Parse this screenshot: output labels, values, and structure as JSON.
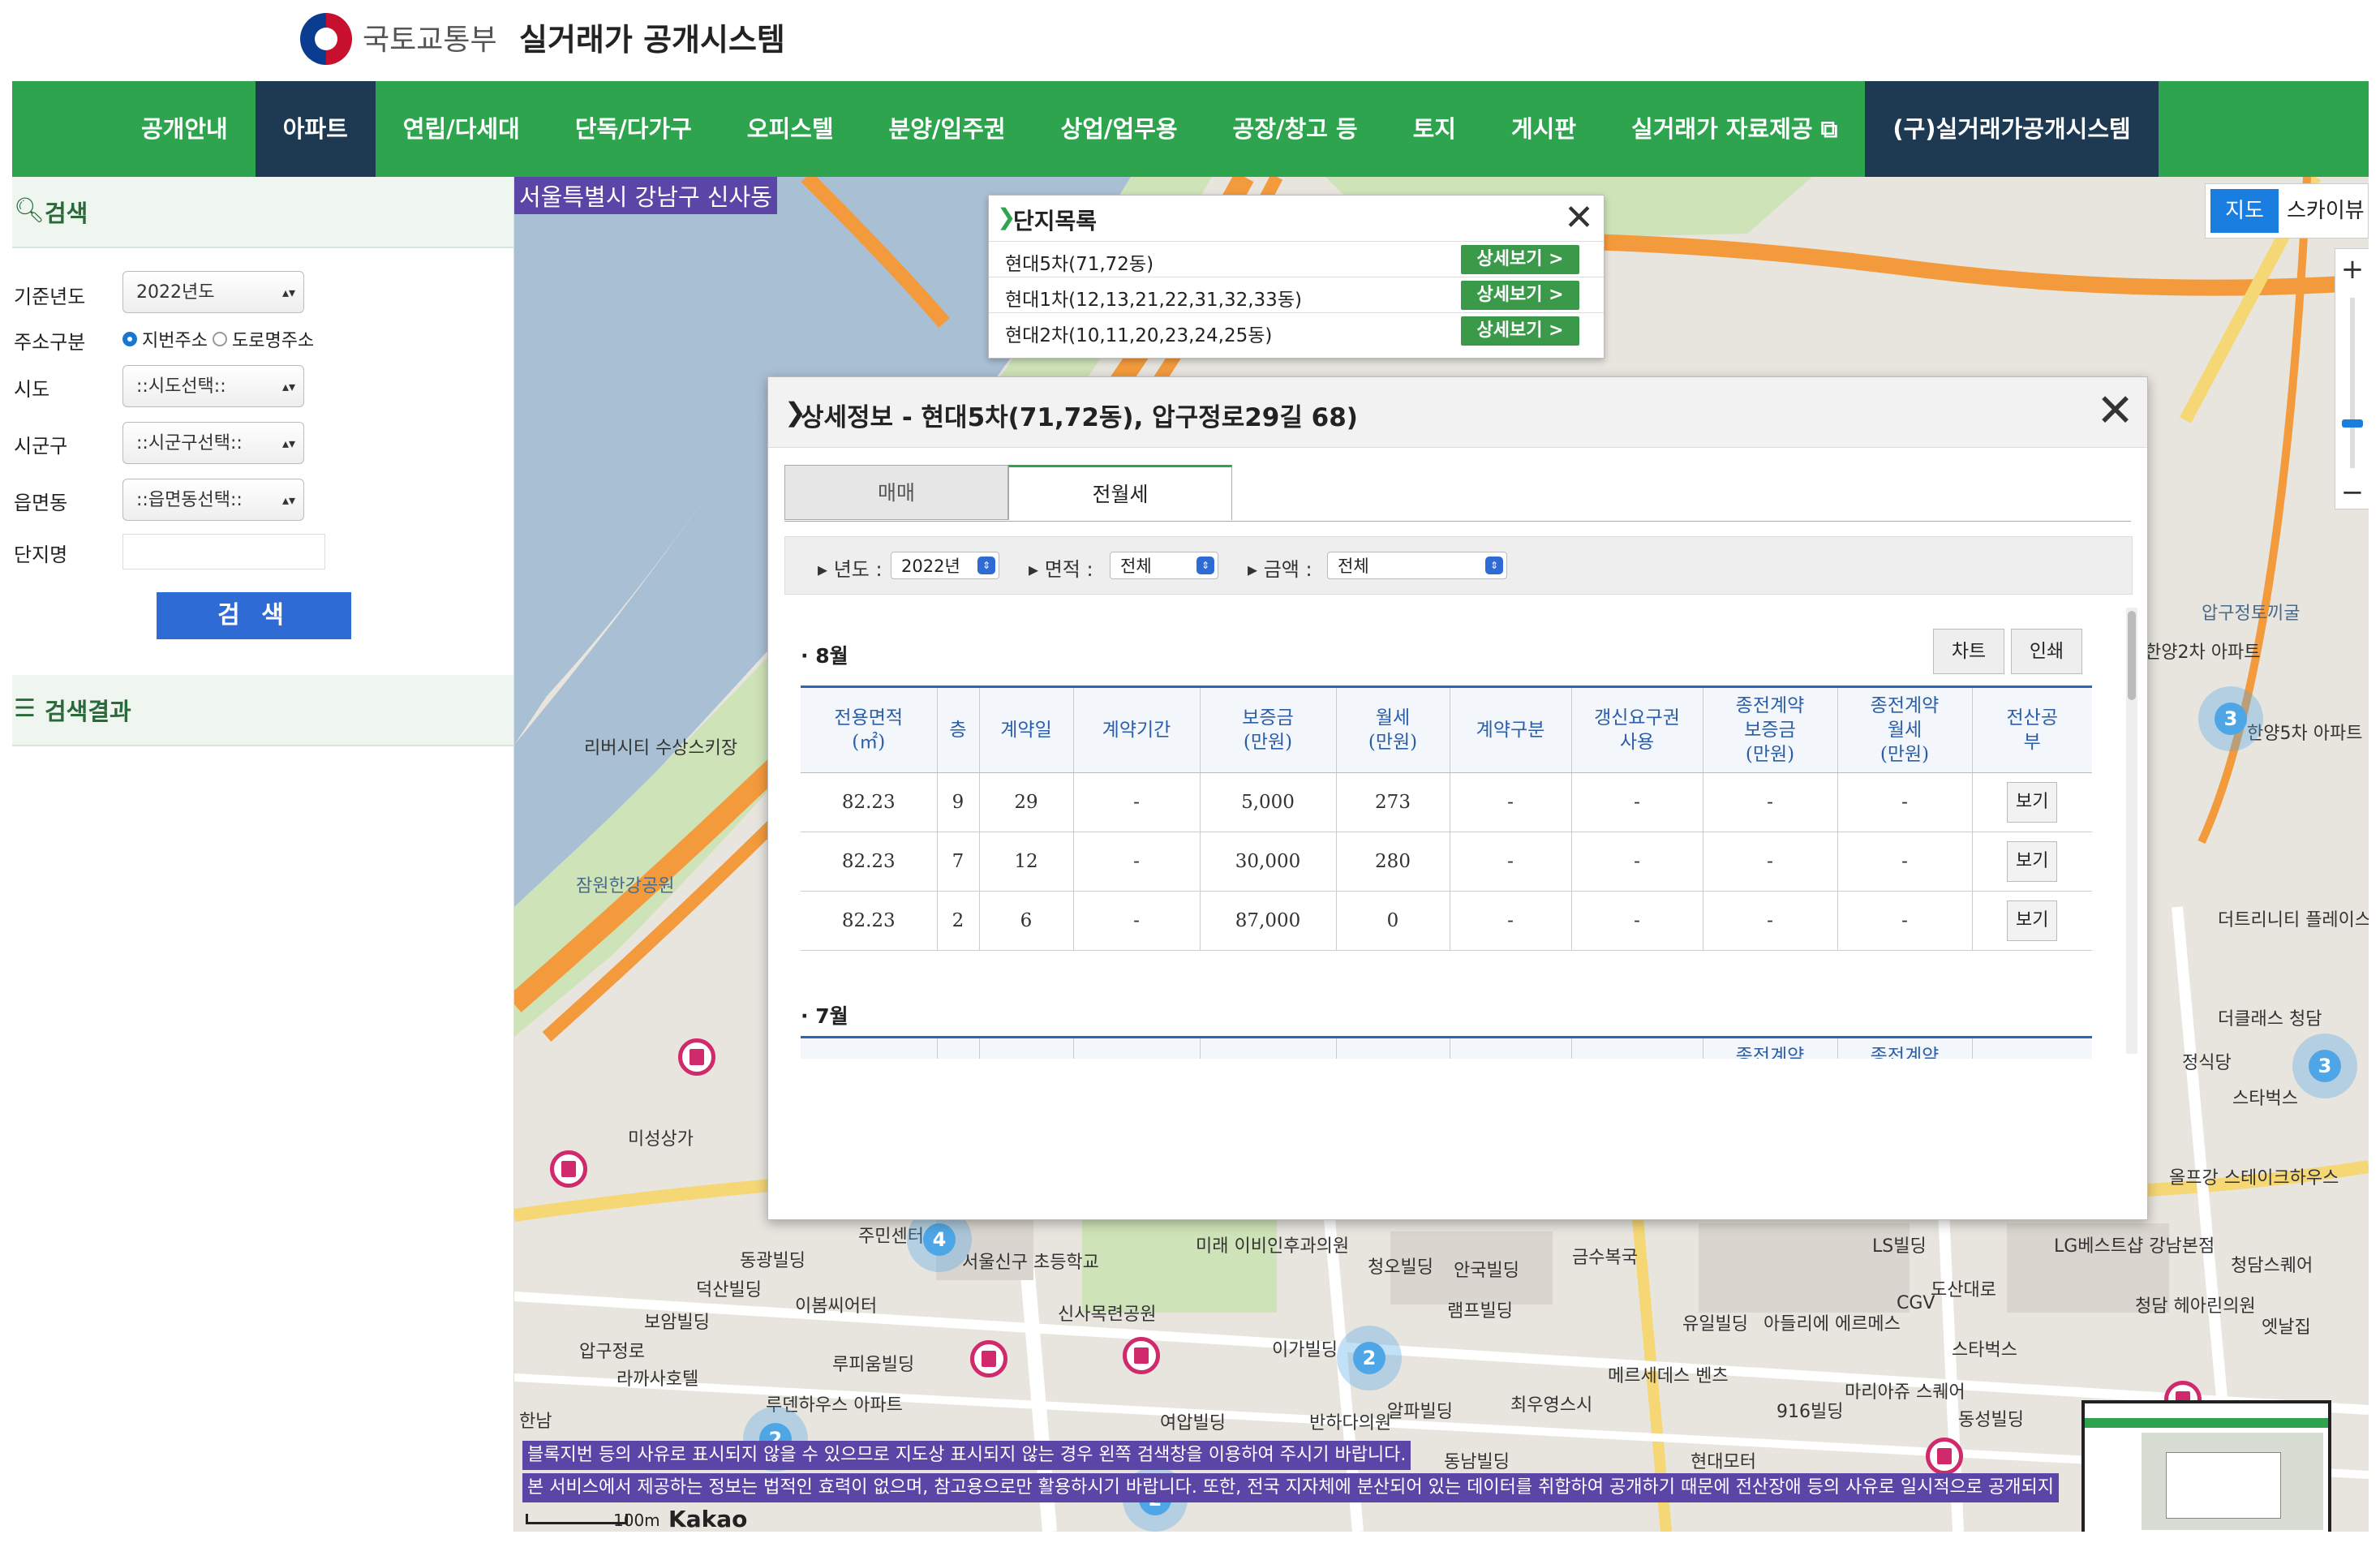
{
  "header": {
    "ministry": "국토교통부",
    "system_name": "실거래가 공개시스템"
  },
  "nav": {
    "items": [
      {
        "label": "공개안내"
      },
      {
        "label": "아파트"
      },
      {
        "label": "연립/다세대"
      },
      {
        "label": "단독/다가구"
      },
      {
        "label": "오피스텔"
      },
      {
        "label": "분양/입주권"
      },
      {
        "label": "상업/업무용"
      },
      {
        "label": "공장/창고 등"
      },
      {
        "label": "토지"
      },
      {
        "label": "게시판"
      },
      {
        "label": "실거래가 자료제공 ⧉"
      },
      {
        "label": "(구)실거래가공개시스템"
      }
    ],
    "active": "아파트"
  },
  "sidebar": {
    "search_title": "검색",
    "year_label": "기준년도",
    "year_value": "2022년도",
    "address_label": "주소구분",
    "addr_opt1": "지번주소",
    "addr_opt2": "도로명주소",
    "sido_label": "시도",
    "sido_value": "::시도선택::",
    "sigungu_label": "시군구",
    "sigungu_value": "::시군구선택::",
    "dong_label": "읍면동",
    "dong_value": "::읍면동선택::",
    "name_label": "단지명",
    "search_button": "검 색",
    "results_title": "검색결과"
  },
  "map": {
    "region": "서울특별시 강남구 신사동",
    "toggle_map": "지도",
    "toggle_sky": "스카이뷰",
    "notice1": "블록지번 등의 사유로 표시되지 않을 수 있으므로 지도상 표시되지 않는 경우 왼쪽 검색창을 이용하여 주시기 바랍니다.",
    "notice2": "본 서비스에서 제공하는 정보는 법적인 효력이 없으며, 참고용으로만 활용하시기 바랍니다. 또한, 전국 지자체에 분산되어 있는 데이터를 취합하여 공개하기 때문에 전산장애 등의 사유로 일시적으로 공개되지",
    "scale": "100m",
    "provider": "Kakao",
    "labels": [
      "리버시티 수상스키장",
      "잠원한강공원",
      "미성상가",
      "압구정토끼굴",
      "한양2차 아파트",
      "한양5차 아파트",
      "더트리니티 플레이스",
      "더클래스 청담",
      "정식당",
      "스타벅스",
      "올프강 스테이크하우스",
      "동광빌딩",
      "덕산빌딩",
      "이봄씨어터",
      "서울신구 초등학교",
      "신사목련공원",
      "미래 이비인후과의원",
      "청오빌딩",
      "안국빌딩",
      "금수복국",
      "LS빌딩",
      "LG베스트샵 강남본점",
      "청담스퀘어",
      "보암빌딩",
      "라까사호텔",
      "루피움빌딩",
      "루덴하우스 아파트",
      "이가빌딩",
      "램프빌딩",
      "유일빌딩",
      "아들리에 에르메스",
      "CGV",
      "스타벅스",
      "청담 헤아린의원",
      "엣날집",
      "여압빌딩",
      "반하다의원",
      "알파빌딩",
      "최우영스시",
      "메르세데스 벤츠",
      "마리아쥬 스퀘어",
      "916빌딩",
      "동성빌딩",
      "동남빌딩",
      "현대모터",
      "주민센터",
      "압구정로",
      "도산대로",
      "한남"
    ],
    "clusters": [
      "3",
      "3",
      "4",
      "2",
      "2",
      "2"
    ]
  },
  "complex_list": {
    "title": "단지목록",
    "rows": [
      {
        "name": "현대5차(71,72동)",
        "button": "상세보기 >"
      },
      {
        "name": "현대1차(12,13,21,22,31,32,33동)",
        "button": "상세보기 >"
      },
      {
        "name": "현대2차(10,11,20,23,24,25동)",
        "button": "상세보기 >"
      }
    ]
  },
  "detail": {
    "title": "상세정보 - 현대5차(71,72동), 압구정로29길 68)",
    "tab_sale": "매매",
    "tab_rent": "전월세",
    "filter_year_label": "년도 :",
    "filter_year_value": "2022년",
    "filter_area_label": "면적 :",
    "filter_area_value": "전체",
    "filter_price_label": "금액 :",
    "filter_price_value": "전체",
    "chart_button": "차트",
    "print_button": "인쇄",
    "columns": [
      "전용면적\n(㎡)",
      "층",
      "계약일",
      "계약기간",
      "보증금\n(만원)",
      "월세\n(만원)",
      "계약구분",
      "갱신요구권\n사용",
      "종전계약\n보증금\n(만원)",
      "종전계약\n월세\n(만원)",
      "전산공\n부"
    ],
    "months": [
      {
        "label": "8월",
        "rows": [
          [
            "82.23",
            "9",
            "29",
            "-",
            "5,000",
            "273",
            "-",
            "-",
            "-",
            "-",
            "보기"
          ],
          [
            "82.23",
            "7",
            "12",
            "-",
            "30,000",
            "280",
            "-",
            "-",
            "-",
            "-",
            "보기"
          ],
          [
            "82.23",
            "2",
            "6",
            "-",
            "87,000",
            "0",
            "-",
            "-",
            "-",
            "-",
            "보기"
          ]
        ]
      },
      {
        "label": "7월",
        "rows": []
      }
    ]
  }
}
